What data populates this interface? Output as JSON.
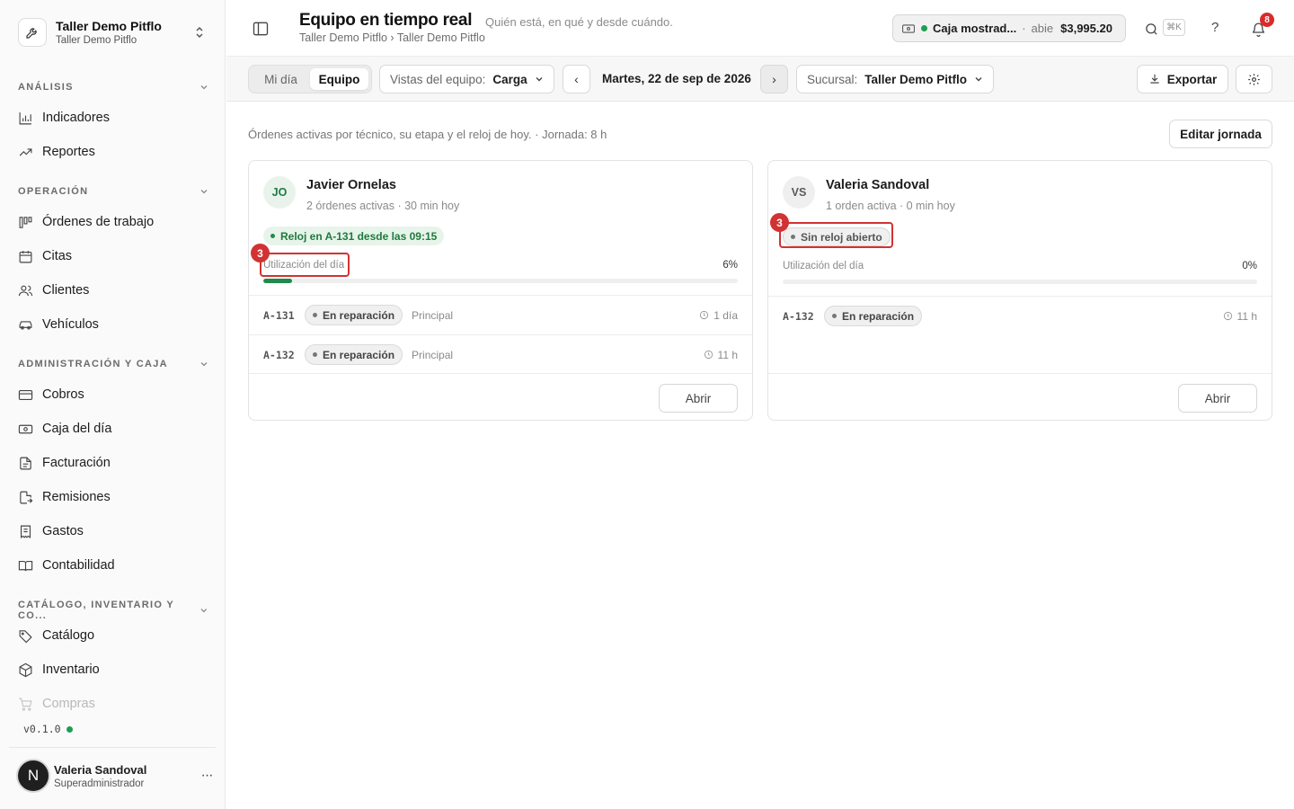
{
  "workspace": {
    "name": "Taller Demo Pitflo",
    "sub": "Taller Demo Pitflo"
  },
  "sections": {
    "analisis": "ANÁLISIS",
    "operacion": "OPERACIÓN",
    "admin": "ADMINISTRACIÓN Y CAJA",
    "catalogo": "CATÁLOGO, INVENTARIO Y CO..."
  },
  "nav": {
    "indicadores": "Indicadores",
    "reportes": "Reportes",
    "ordenes": "Órdenes de trabajo",
    "citas": "Citas",
    "clientes": "Clientes",
    "vehiculos": "Vehículos",
    "cobros": "Cobros",
    "caja": "Caja del día",
    "facturacion": "Facturación",
    "remisiones": "Remisiones",
    "gastos": "Gastos",
    "contabilidad": "Contabilidad",
    "catalogo": "Catálogo",
    "inventario": "Inventario",
    "compras": "Compras"
  },
  "version": "v0.1.0",
  "user": {
    "initial": "N",
    "name": "Valeria Sandoval",
    "role": "Superadministrador",
    "more": "···"
  },
  "header": {
    "title": "Equipo en tiempo real",
    "subtitle": "Quién está, en qué y desde cuándo.",
    "breadcrumb": "Taller Demo Pitflo › Taller Demo Pitflo",
    "caja": {
      "name": "Caja mostrad...",
      "sep": "·",
      "status": "abie",
      "amount": "$3,995.20"
    },
    "shortcut": "⌘K",
    "help": "?",
    "notifications": "8"
  },
  "toolbar": {
    "tabs": [
      "Mi día",
      "Equipo"
    ],
    "active_tab": "Equipo",
    "views_label": "Vistas del equipo:",
    "views_value": "Carga",
    "prev": "‹",
    "next": "›",
    "date": "Martes, 22 de sep de 2026",
    "branch_label": "Sucursal:",
    "branch_value": "Taller Demo Pitflo",
    "export": "Exportar"
  },
  "main": {
    "description": "Órdenes activas por técnico, su etapa y el reloj de hoy. · Jornada: 8 h",
    "edit_button": "Editar jornada"
  },
  "technicians": [
    {
      "initials": "JO",
      "name": "Javier Ornelas",
      "meta": "2 órdenes activas · 30 min hoy",
      "clock": "Reloj en A-131 desde las 09:15",
      "util_label": "Utilización del día",
      "util_value": "6%",
      "utilization": 0.06,
      "orders": [
        {
          "code": "A-131",
          "stage": "En reparación",
          "location": "Principal",
          "time": "1 día"
        },
        {
          "code": "A-132",
          "stage": "En reparación",
          "location": "Principal",
          "time": "11 h"
        }
      ],
      "action": "Abrir"
    },
    {
      "initials": "VS",
      "name": "Valeria Sandoval",
      "meta": "1 orden activa · 0 min hoy",
      "clock": "Sin reloj abierto",
      "util_label": "Utilización del día",
      "util_value": "0%",
      "utilization": 0,
      "orders": [
        {
          "code": "A-132",
          "stage": "En reparación",
          "time": "11 h"
        }
      ],
      "action": "Abrir"
    }
  ],
  "markers": [
    "3",
    "3"
  ],
  "colors": {
    "accent": "#1f8a4c",
    "highlight": "#d23232",
    "badge": "#d92b2b"
  }
}
